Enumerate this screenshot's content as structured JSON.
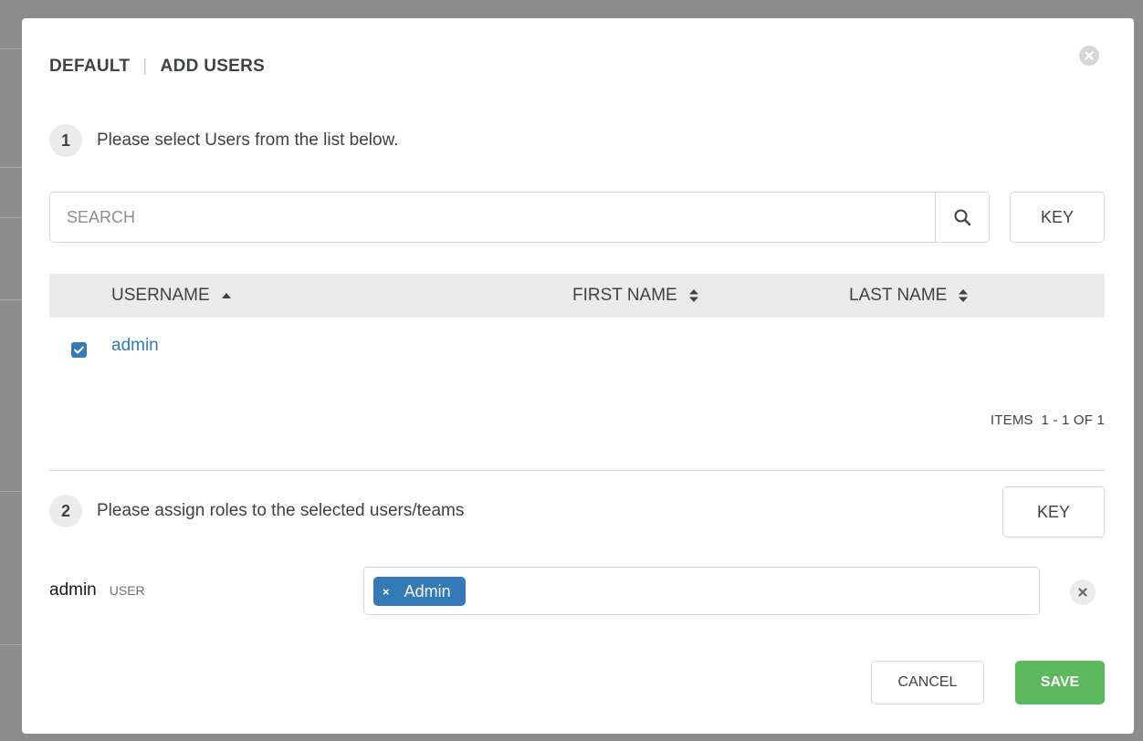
{
  "header": {
    "context": "DEFAULT",
    "title": "ADD USERS"
  },
  "step1": {
    "number": "1",
    "text": "Please select Users from the list below."
  },
  "search": {
    "placeholder": "SEARCH",
    "value": ""
  },
  "key_label": "KEY",
  "table": {
    "columns": [
      "USERNAME",
      "FIRST NAME",
      "LAST NAME"
    ],
    "sort": {
      "column": "USERNAME",
      "direction": "ascending"
    },
    "rows": [
      {
        "username": "admin",
        "first_name": "",
        "last_name": "",
        "selected": true
      }
    ],
    "pagination": "ITEMS  1 - 1 OF 1"
  },
  "step2": {
    "number": "2",
    "text": "Please assign roles to the selected users/teams"
  },
  "assignment": {
    "user": "admin",
    "type": "USER",
    "roles": [
      {
        "remove": "×",
        "label": "Admin"
      }
    ]
  },
  "footer": {
    "cancel_label": "CANCEL",
    "save_label": "SAVE"
  },
  "colors": {
    "link": "#337ab7",
    "tag": "#337ab7",
    "save": "#5cb85c",
    "overlay": "#8c8c8c"
  },
  "icons": [
    "close-icon",
    "search-icon",
    "sort-up-icon",
    "sort-both-icon",
    "check-icon",
    "remove-icon"
  ]
}
